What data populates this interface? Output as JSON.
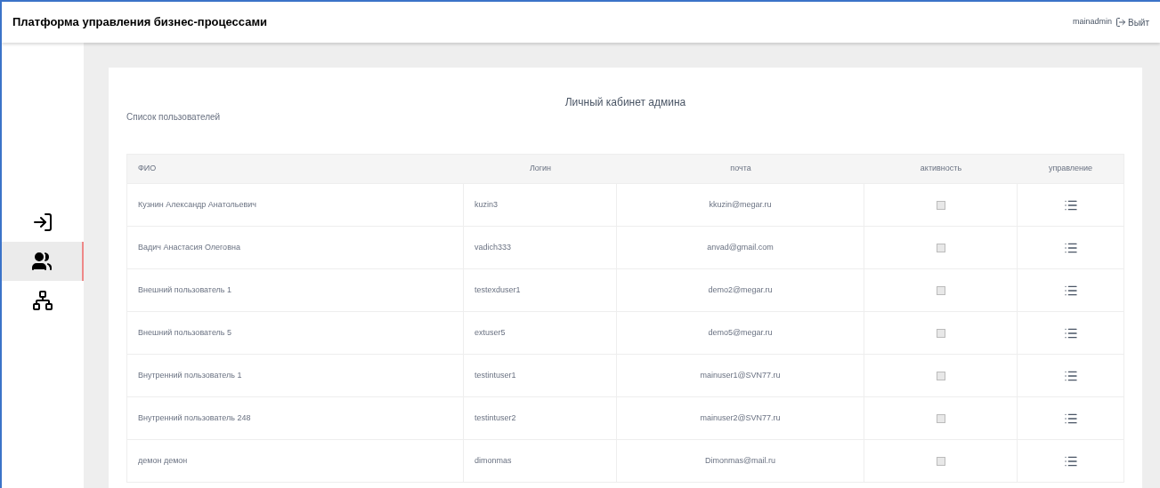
{
  "header": {
    "title": "Платформа управления бизнес-процессами",
    "user": "mainadmin",
    "logout": "Выйт"
  },
  "sidebar": {
    "items": [
      {
        "kind": "login",
        "selected": false
      },
      {
        "kind": "users",
        "selected": true
      },
      {
        "kind": "structure",
        "selected": false
      }
    ]
  },
  "page": {
    "title": "Личный кабинет админа",
    "subtitle": "Список пользователей"
  },
  "table": {
    "columns": [
      "ФИО",
      "Логин",
      "почта",
      "активность",
      "управление"
    ],
    "rows": [
      {
        "name": "Кузнин Александр Анатольевич",
        "login": "kuzin3",
        "email": "kkuzin@megar.ru",
        "active": false
      },
      {
        "name": "Вадич Анастасия Олеговна",
        "login": "vadich333",
        "email": "anvad@gmail.com",
        "active": false
      },
      {
        "name": "Внешний пользователь 1",
        "login": "testexduser1",
        "email": "demo2@megar.ru",
        "active": false
      },
      {
        "name": "Внешний пользователь 5",
        "login": "extuser5",
        "email": "demo5@megar.ru",
        "active": false
      },
      {
        "name": "Внутренний пользователь 1",
        "login": "testintuser1",
        "email": "mainuser1@SVN77.ru",
        "active": false
      },
      {
        "name": "Внутренний пользователь 248",
        "login": "testintuser2",
        "email": "mainuser2@SVN77.ru",
        "active": false
      },
      {
        "name": "демон демон",
        "login": "dimonmas",
        "email": "Dimonmas@mail.ru",
        "active": false
      }
    ]
  }
}
